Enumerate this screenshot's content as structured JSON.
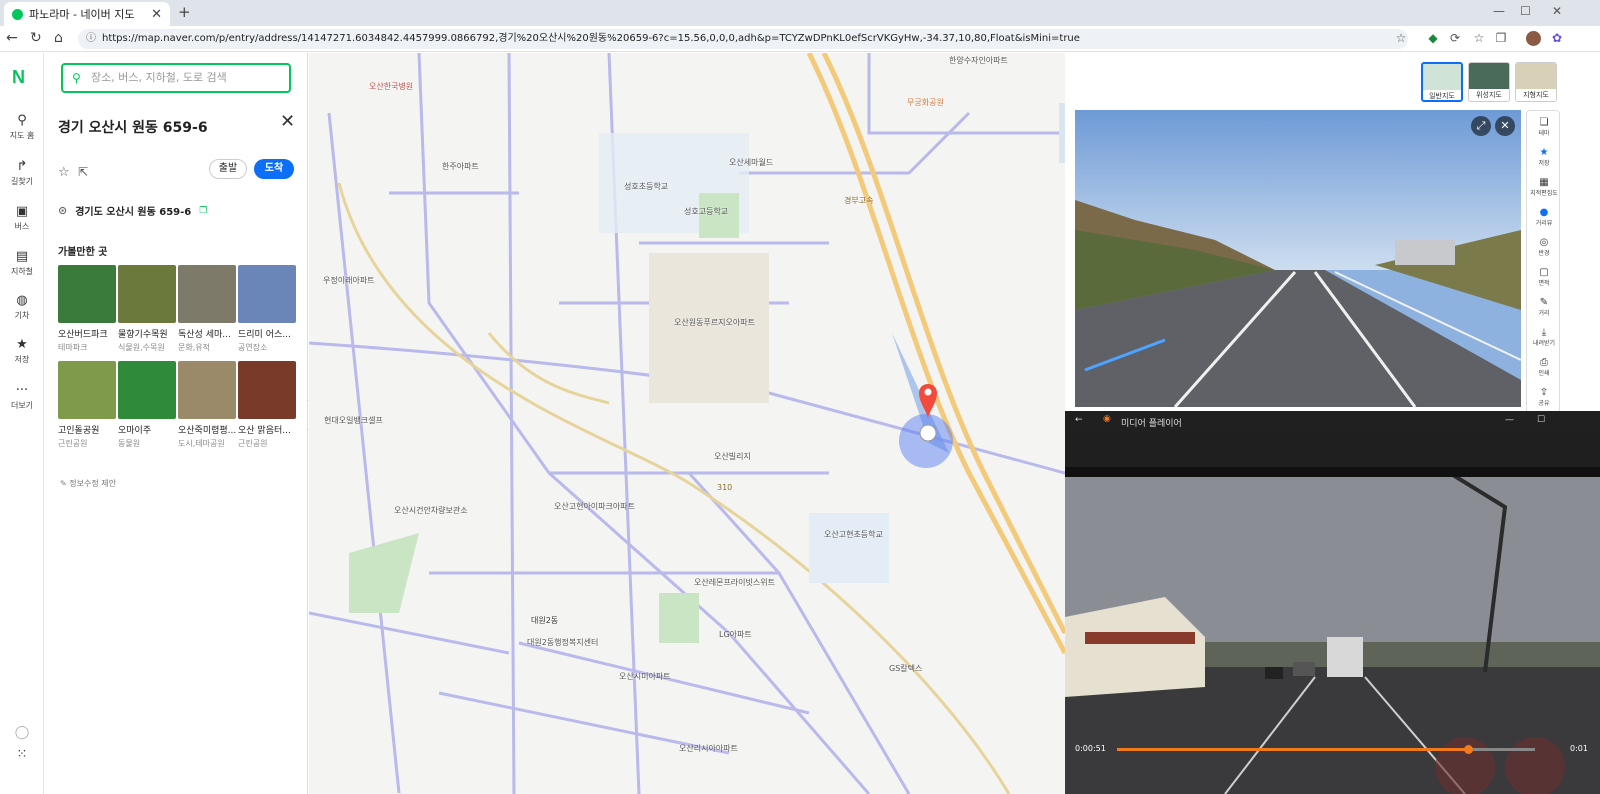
{
  "browser": {
    "tab_title": "파노라마 - 네이버 지도",
    "url": "https://map.naver.com/p/entry/address/14147271.6034842.4457999.0866792,경기%20오산시%20원동%20659-6?c=15.56,0,0,0,adh&p=TCYZwDPnKL0efScrVKGyHw,-34.37,10,80,Float&isMini=true"
  },
  "rail": {
    "logo": "N",
    "items": [
      {
        "label": "지도 홈",
        "icon": "map-pin-icon"
      },
      {
        "label": "길찾기",
        "icon": "route-arrow-icon"
      },
      {
        "label": "버스",
        "icon": "bus-icon"
      },
      {
        "label": "지하철",
        "icon": "subway-icon"
      },
      {
        "label": "기차",
        "icon": "train-icon"
      },
      {
        "label": "저장",
        "icon": "star-icon"
      },
      {
        "label": "더보기",
        "icon": "more-icon"
      }
    ]
  },
  "panel": {
    "search_placeholder": "장소, 버스, 지하철, 도로 검색",
    "title": "경기 오산시 원동 659-6",
    "btn_depart": "출발",
    "btn_arrive": "도착",
    "address": "경기도 오산시 원동 659-6",
    "nearby_title": "가볼만한 곳",
    "places": [
      {
        "name": "오산버드파크",
        "category": "테마파크",
        "color": "#3a7a3a"
      },
      {
        "name": "물향기수목원",
        "category": "식물원,수목원",
        "color": "#6b7a3c"
      },
      {
        "name": "독산성 세마...",
        "category": "문화,유적",
        "color": "#7d7a6a"
      },
      {
        "name": "드리미 어스...",
        "category": "공연장소",
        "color": "#6a86b8"
      },
      {
        "name": "고인돌공원",
        "category": "근린공원",
        "color": "#7f9a4a"
      },
      {
        "name": "오마이주",
        "category": "동물원",
        "color": "#2f8a3a"
      },
      {
        "name": "오산죽미령평...",
        "category": "도시,테마공원",
        "color": "#9a8a6a"
      },
      {
        "name": "오산 맑음터...",
        "category": "근린공원",
        "color": "#7a3a2a"
      }
    ],
    "feedback": "정보수정 제안"
  },
  "map": {
    "labels": [
      {
        "t": "오산한국병원",
        "c": "#c0504d"
      },
      {
        "t": "무궁화공원",
        "c": "#d9773a"
      },
      {
        "t": "한양수자인아파트",
        "c": "#555"
      },
      {
        "t": "오산세마월드",
        "c": "#555"
      },
      {
        "t": "성호초등학교",
        "c": "#555"
      },
      {
        "t": "성호고등학교",
        "c": "#555"
      },
      {
        "t": "한주아파트",
        "c": "#555"
      },
      {
        "t": "오산원동푸르지오아파트",
        "c": "#555"
      },
      {
        "t": "우정이래아파트",
        "c": "#555"
      },
      {
        "t": "현대오일뱅크셀프",
        "c": "#555"
      },
      {
        "t": "오산빌리지",
        "c": "#555"
      },
      {
        "t": "오산고현아이파크아파트",
        "c": "#555"
      },
      {
        "t": "오산시건안차량보관소",
        "c": "#555"
      },
      {
        "t": "오산고현초등학교",
        "c": "#555"
      },
      {
        "t": "오산레몬프라이빗스위트",
        "c": "#555"
      },
      {
        "t": "대원2동",
        "c": "#333"
      },
      {
        "t": "대원2동행정복지센터",
        "c": "#555"
      },
      {
        "t": "LG아파트",
        "c": "#555"
      },
      {
        "t": "오산시미아파트",
        "c": "#555"
      },
      {
        "t": "GS칼텍스",
        "c": "#555"
      },
      {
        "t": "오산리시아아파트",
        "c": "#555"
      },
      {
        "t": "경부고속",
        "c": "#8a6a2a"
      },
      {
        "t": "310",
        "c": "#8a6a2a"
      }
    ],
    "map_types": [
      {
        "label": "일반지도",
        "color": "#cfe3d6"
      },
      {
        "label": "위성지도",
        "color": "#4a6a5a"
      },
      {
        "label": "지형지도",
        "color": "#d9d0b8"
      }
    ]
  },
  "tools": [
    {
      "label": "테마",
      "icon": "layers-icon"
    },
    {
      "label": "저장",
      "icon": "star-icon"
    },
    {
      "label": "지적편집도",
      "icon": "grid-icon"
    },
    {
      "label": "거리뷰",
      "icon": "streetview-icon"
    },
    {
      "label": "반경",
      "icon": "radius-icon"
    },
    {
      "label": "면적",
      "icon": "area-icon"
    },
    {
      "label": "거리",
      "icon": "ruler-icon"
    },
    {
      "label": "내려받기",
      "icon": "download-icon"
    },
    {
      "label": "인쇄",
      "icon": "print-icon"
    },
    {
      "label": "공유",
      "icon": "share-icon"
    }
  ],
  "media_player": {
    "title": "미디어 플레이어",
    "time_current": "0:00:51",
    "time_end": "0:01",
    "progress": 0.84
  }
}
